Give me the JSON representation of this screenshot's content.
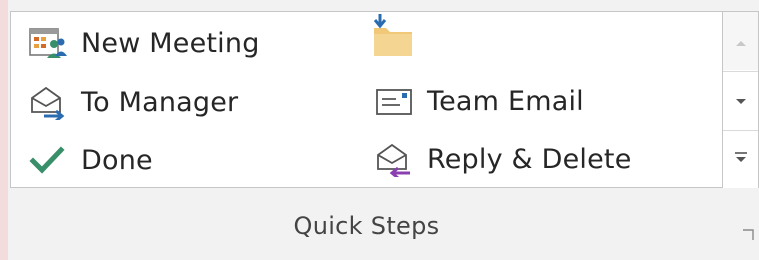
{
  "group": {
    "label": "Quick Steps"
  },
  "quick_steps": [
    {
      "label": "New Meeting",
      "icon": "new-meeting-icon"
    },
    {
      "label": "To Manager",
      "icon": "forward-envelope-icon"
    },
    {
      "label": "Done",
      "icon": "checkmark-icon"
    },
    {
      "label": "",
      "icon": "move-to-folder-icon"
    },
    {
      "label": "Team Email",
      "icon": "team-email-icon"
    },
    {
      "label": "Reply & Delete",
      "icon": "reply-delete-icon"
    }
  ],
  "gallery_controls": {
    "scroll_up_icon": "scroll-up-icon",
    "scroll_down_icon": "scroll-down-icon",
    "more_icon": "gallery-more-icon"
  },
  "colors": {
    "accent_blue": "#2b6cb0",
    "check_green": "#3a8f6b",
    "reply_purple": "#8a3fb0",
    "folder_tan": "#f0c878"
  }
}
